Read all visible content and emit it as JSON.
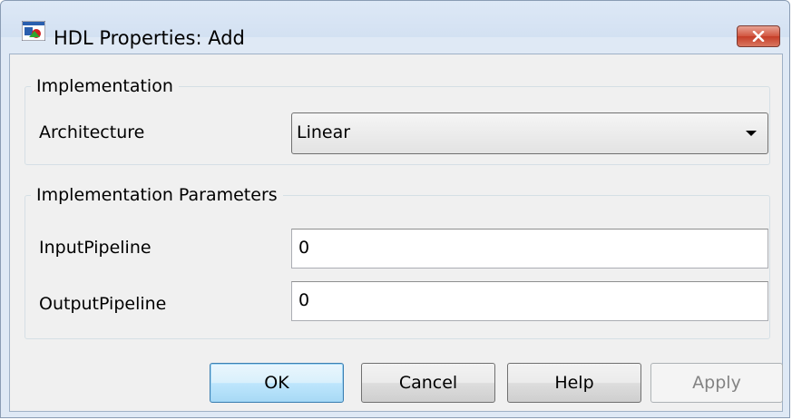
{
  "window": {
    "title": "HDL Properties: Add",
    "icon": "simulink-block-icon",
    "close_icon": "close-icon"
  },
  "implementation": {
    "group_label": "Implementation",
    "architecture_label": "Architecture",
    "architecture_value": "Linear"
  },
  "parameters": {
    "group_label": "Implementation Parameters",
    "input_pipeline_label": "InputPipeline",
    "input_pipeline_value": "0",
    "output_pipeline_label": "OutputPipeline",
    "output_pipeline_value": "0"
  },
  "buttons": {
    "ok": "OK",
    "cancel": "Cancel",
    "help": "Help",
    "apply": "Apply"
  }
}
